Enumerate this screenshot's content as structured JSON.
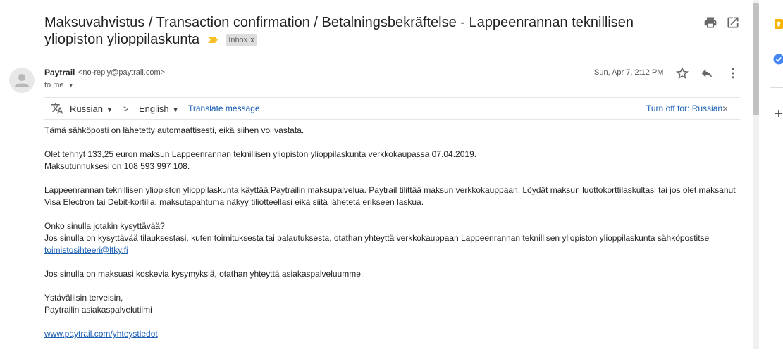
{
  "email": {
    "subject_line1": "Maksuvahvistus / Transaction confirmation / Betalningsbekräftelse - Lappeenrannan teknillisen",
    "subject_line2": "yliopiston ylioppilaskunta",
    "label": "Inbox",
    "label_close": "x",
    "sender_name": "Paytrail",
    "sender_email": "<no-reply@paytrail.com>",
    "to": "to me",
    "date": "Sun, Apr 7, 2:12 PM"
  },
  "icons": {
    "print": "print-icon",
    "open_new_window": "open-in-new-window-icon",
    "star": "star-icon",
    "reply": "reply-icon",
    "more": "more-vert-icon",
    "translate": "translate-icon"
  },
  "translate_bar": {
    "source_lang": "Russian",
    "arrow": ">",
    "target_lang": "English",
    "translate_link": "Translate message",
    "turn_off": "Turn off for: Russian",
    "close": "×"
  },
  "body": {
    "p1": "Tämä sähköposti on lähetetty automaattisesti, eikä siihen voi vastata.",
    "p2_l1": "Olet tehnyt 133,25 euron maksun Lappeenrannan teknillisen yliopiston ylioppilaskunta verkkokaupassa 07.04.2019.",
    "p2_l2": "Maksutunnuksesi on 108 593 997 108.",
    "p3": "Lappeenrannan teknillisen yliopiston ylioppilaskunta käyttää Paytrailin maksupalvelua. Paytrail tilittää maksun verkkokauppaan. Löydät maksun luottokorttilaskultasi tai jos olet maksanut Visa Electron tai Debit-kortilla, maksutapahtuma näkyy tiliotteellasi eikä siitä lähetetä erikseen laskua.",
    "p4_l1": "Onko sinulla jotakin kysyttävää?",
    "p4_l2": "Jos sinulla on kysyttävää tilauksestasi, kuten toimituksesta tai palautuksesta, otathan yhteyttä verkkokauppaan Lappeenrannan teknillisen yliopiston ylioppilaskunta sähköpostitse",
    "p4_link": "toimistosihteeri@ltky.fi",
    "p5": "Jos sinulla on maksuasi koskevia kysymyksiä, otathan yhteyttä asiakaspalveluumme.",
    "p6_l1": "Ystävällisin terveisin,",
    "p6_l2": "Paytrailin asiakaspalvelutiimi",
    "p7_link": "www.paytrail.com/yhteystiedot"
  },
  "colors": {
    "link": "#1a5fb4",
    "important_marker": "#f6c026",
    "rail_yellow": "#f6b400",
    "rail_blue": "#4285f4"
  }
}
